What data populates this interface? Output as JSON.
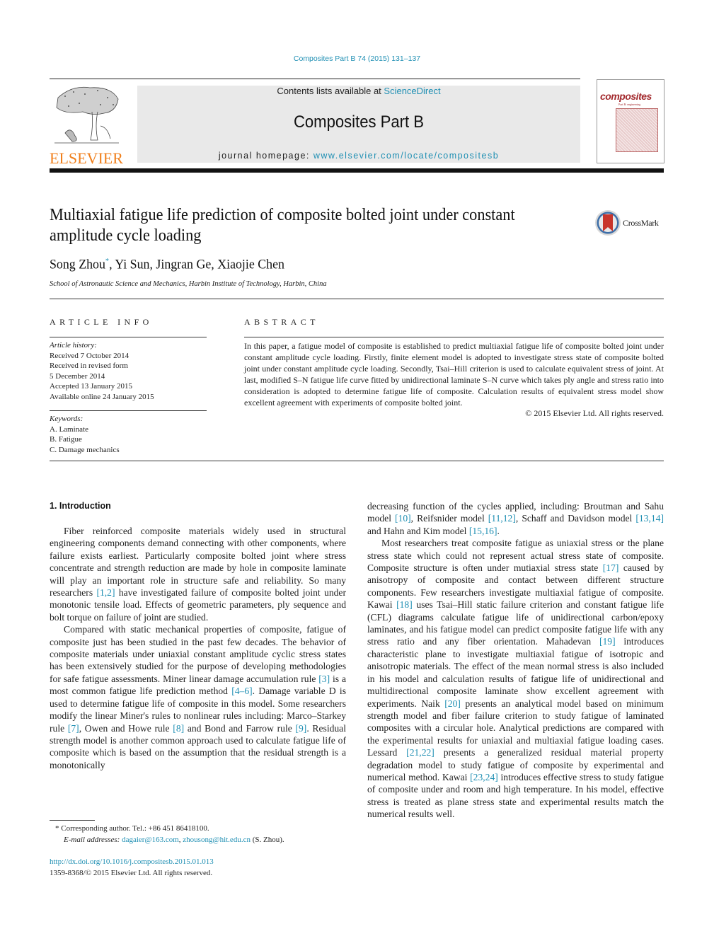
{
  "header": {
    "citation": "Composites Part B 74 (2015) 131–137",
    "publisher_logo_text": "ELSEVIER",
    "contents_prefix": "Contents lists available at ",
    "contents_link": "ScienceDirect",
    "journal_title": "Composites Part B",
    "homepage_prefix": "journal homepage: ",
    "homepage_link": "www.elsevier.com/locate/compositesb",
    "cover_title": "composites",
    "cover_subtitle": "Part B: engineering"
  },
  "article": {
    "title": "Multiaxial fatigue life prediction of composite bolted joint under constant amplitude cycle loading",
    "crossmark_label": "CrossMark",
    "authors": [
      {
        "name": "Song Zhou",
        "mark": "*"
      },
      {
        "name": "Yi Sun"
      },
      {
        "name": "Jingran Ge"
      },
      {
        "name": "Xiaojie Chen"
      }
    ],
    "affiliation": "School of Astronautic Science and Mechanics, Harbin Institute of Technology, Harbin, China"
  },
  "article_info": {
    "heading": "ARTICLE INFO",
    "history_label": "Article history:",
    "history": [
      "Received 7 October 2014",
      "Received in revised form",
      "5 December 2014",
      "Accepted 13 January 2015",
      "Available online 24 January 2015"
    ],
    "keywords_label": "Keywords:",
    "keywords": [
      "A. Laminate",
      "B. Fatigue",
      "C. Damage mechanics"
    ]
  },
  "abstract": {
    "heading": "ABSTRACT",
    "text": "In this paper, a fatigue model of composite is established to predict multiaxial fatigue life of composite bolted joint under constant amplitude cycle loading. Firstly, finite element model is adopted to investigate stress state of composite bolted joint under constant amplitude cycle loading. Secondly, Tsai–Hill criterion is used to calculate equivalent stress of joint. At last, modified S–N fatigue life curve fitted by unidirectional laminate S–N curve which takes ply angle and stress ratio into consideration is adopted to determine fatigue life of composite. Calculation results of equivalent stress model show excellent agreement with experiments of composite bolted joint.",
    "copyright": "© 2015 Elsevier Ltd. All rights reserved."
  },
  "introduction": {
    "heading": "1.  Introduction",
    "left_paragraphs": [
      [
        {
          "t": "Fiber reinforced composite materials widely used in structural engineering components demand connecting with other components, where failure exists earliest. Particularly composite bolted joint where stress concentrate and strength reduction are made by hole in composite laminate will play an important role in structure safe and reliability. So many researchers "
        },
        {
          "ref": "[1,2]"
        },
        {
          "t": " have investigated failure of composite bolted joint under monotonic tensile load. Effects of geometric parameters, ply sequence and bolt torque on failure of joint are studied."
        }
      ],
      [
        {
          "t": "Compared with static mechanical properties of composite, fatigue of composite just has been studied in the past few decades. The behavior of composite materials under uniaxial constant amplitude cyclic stress states has been extensively studied for the purpose of developing methodologies for safe fatigue assessments. Miner linear damage accumulation rule "
        },
        {
          "ref": "[3]"
        },
        {
          "t": " is a most common fatigue life prediction method "
        },
        {
          "ref": "[4–6]"
        },
        {
          "t": ". Damage variable D is used to determine fatigue life of composite in this model. Some researchers modify the linear Miner's rules to nonlinear rules including: Marco–Starkey rule "
        },
        {
          "ref": "[7]"
        },
        {
          "t": ", Owen and Howe rule "
        },
        {
          "ref": "[8]"
        },
        {
          "t": " and Bond and Farrow rule "
        },
        {
          "ref": "[9]"
        },
        {
          "t": ". Residual strength model is another common approach used to calculate fatigue life of composite which is based on the assumption that the residual strength is a monotonically"
        }
      ]
    ],
    "right_paragraphs": [
      [
        {
          "t": "decreasing function of the cycles applied, including: Broutman and Sahu model "
        },
        {
          "ref": "[10]"
        },
        {
          "t": ", Reifsnider model "
        },
        {
          "ref": "[11,12]"
        },
        {
          "t": ", Schaff and Davidson model "
        },
        {
          "ref": "[13,14]"
        },
        {
          "t": " and Hahn and Kim model "
        },
        {
          "ref": "[15,16]"
        },
        {
          "t": "."
        }
      ],
      [
        {
          "t": "Most researchers treat composite fatigue as uniaxial stress or the plane stress state which could not represent actual stress state of composite. Composite structure is often under mutiaxial stress state "
        },
        {
          "ref": "[17]"
        },
        {
          "t": " caused by anisotropy of composite and contact between different structure components. Few researchers investigate multiaxial fatigue of composite. Kawai "
        },
        {
          "ref": "[18]"
        },
        {
          "t": " uses Tsai–Hill static failure criterion and constant fatigue life (CFL) diagrams calculate fatigue life of unidirectional carbon/epoxy laminates, and his fatigue model can predict composite fatigue life with any stress ratio and any fiber orientation. Mahadevan "
        },
        {
          "ref": "[19]"
        },
        {
          "t": " introduces characteristic plane to investigate multiaxial fatigue of isotropic and anisotropic materials. The effect of the mean normal stress is also included in his model and calculation results of fatigue life of unidirectional and multidirectional composite laminate show excellent agreement with experiments. Naik "
        },
        {
          "ref": "[20]"
        },
        {
          "t": " presents an analytical model based on minimum strength model and fiber failure criterion to study fatigue of laminated composites with a circular hole. Analytical predictions are compared with the experimental results for uniaxial and multiaxial fatigue loading cases. Lessard "
        },
        {
          "ref": "[21,22]"
        },
        {
          "t": " presents a generalized residual material property degradation model to study fatigue of composite by experimental and numerical method. Kawai "
        },
        {
          "ref": "[23,24]"
        },
        {
          "t": " introduces effective stress to study fatigue of composite under and room and high temperature. In his model, effective stress is treated as plane stress state and experimental results match the numerical results well."
        }
      ]
    ]
  },
  "footnote": {
    "mark": "*",
    "corresponding": "Corresponding author. Tel.: +86 451 86418100.",
    "email_label": "E-mail addresses: ",
    "email1": "dagaier@163.com",
    "email2": "zhousong@hit.edu.cn",
    "email_suffix": " (S. Zhou)."
  },
  "footer": {
    "doi": "http://dx.doi.org/10.1016/j.compositesb.2015.01.013",
    "issn_copyright": "1359-8368/© 2015 Elsevier Ltd. All rights reserved."
  },
  "colors": {
    "link": "#1f8fb3",
    "elsevier_orange": "#f07f1b",
    "banner_gray": "#e9e9e9",
    "cover_red": "#a32a2e"
  }
}
